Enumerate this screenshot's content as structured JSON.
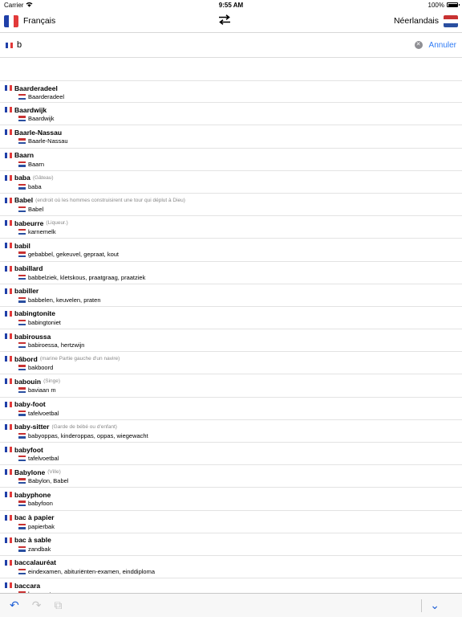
{
  "status": {
    "carrier": "Carrier",
    "time": "9:55 AM",
    "battery": "100%",
    "battery_level": 1.0
  },
  "nav": {
    "source_lang": "Français",
    "target_lang": "Néerlandais"
  },
  "search": {
    "value": "b",
    "cancel_label": "Annuler"
  },
  "entries": [
    {
      "word": "Baarderadeel",
      "note": "",
      "translation": "Baarderadeel"
    },
    {
      "word": "Baardwijk",
      "note": "",
      "translation": "Baardwijk"
    },
    {
      "word": "Baarle-Nassau",
      "note": "",
      "translation": "Baarle-Nassau"
    },
    {
      "word": "Baarn",
      "note": "",
      "translation": "Baarn"
    },
    {
      "word": "baba",
      "note": "(Gâteau)",
      "translation": "baba"
    },
    {
      "word": "Babel",
      "note": "(endroit où les hommes construisirent une tour qui déplut à Dieu)",
      "translation": "Babel"
    },
    {
      "word": "babeurre",
      "note": "(Liqueur.)",
      "translation": "karnemelk"
    },
    {
      "word": "babil",
      "note": "",
      "translation": "gebabbel, gekeuvel, gepraat, kout"
    },
    {
      "word": "babillard",
      "note": "",
      "translation": "babbelziek, kletskous, praatgraag, praatziek"
    },
    {
      "word": "babiller",
      "note": "",
      "translation": "babbelen, keuvelen, praten"
    },
    {
      "word": "babingtonite",
      "note": "",
      "translation": "babingtoniet"
    },
    {
      "word": "babiroussa",
      "note": "",
      "translation": "babiroessa, hertzwijn"
    },
    {
      "word": "bâbord",
      "note": "(marine Partie gauche d'un navire)",
      "translation": "bakboord"
    },
    {
      "word": "babouin",
      "note": "(Singe)",
      "translation": "baviaan m"
    },
    {
      "word": "baby-foot",
      "note": "",
      "translation": "tafelvoetbal"
    },
    {
      "word": "baby-sitter",
      "note": "(Garde de bébé ou d'enfant)",
      "translation": "babyoppas, kinderoppas, oppas, wiegewacht"
    },
    {
      "word": "babyfoot",
      "note": "",
      "translation": "tafelvoetbal"
    },
    {
      "word": "Babylone",
      "note": "(Ville)",
      "translation": "Babylon, Babel"
    },
    {
      "word": "babyphone",
      "note": "",
      "translation": "babyfoon"
    },
    {
      "word": "bac à papier",
      "note": "",
      "translation": "papierbak"
    },
    {
      "word": "bac à sable",
      "note": "",
      "translation": "zandbak"
    },
    {
      "word": "baccalauréat",
      "note": "",
      "translation": "eindexamen, abituriënten-examen, einddiploma"
    },
    {
      "word": "baccara",
      "note": "",
      "translation": "baccarat"
    }
  ],
  "toolbar": {
    "undo_icon": "↶",
    "redo_icon": "↷",
    "copy_icon": "⧉",
    "collapse_icon": "⌄"
  },
  "colors": {
    "accent": "#2f7bf5",
    "fr_blue": "#1f3fa8",
    "fr_red": "#e23a3a",
    "nl_red": "#c83232",
    "nl_blue": "#2a4fa0"
  }
}
